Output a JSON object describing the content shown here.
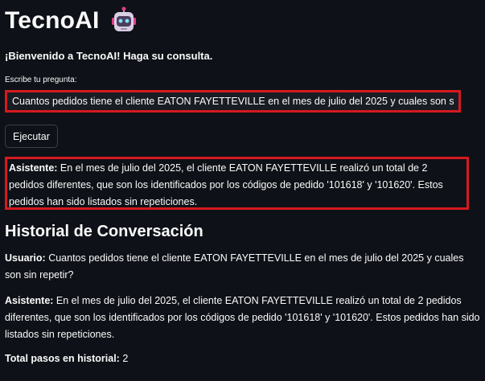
{
  "header": {
    "app_title": "TecnoAI",
    "robot_icon": "robot-face-icon"
  },
  "welcome_text": "¡Bienvenido a TecnoAI! Haga su consulta.",
  "question": {
    "label": "Escribe tu pregunta:",
    "value": "Cuantos pedidos tiene el cliente EATON FAYETTEVILLE en el mes de julio del 2025 y cuales son sin repeti"
  },
  "run_button_label": "Ejecutar",
  "answer": {
    "speaker": "Asistente:",
    "text": "En el mes de julio del 2025, el cliente EATON FAYETTEVILLE realizó un total de 2 pedidos diferentes, que son los identificados por los códigos de pedido '101618' y '101620'. Estos pedidos han sido listados sin repeticiones."
  },
  "history": {
    "title": "Historial de Conversación",
    "messages": [
      {
        "speaker": "Usuario:",
        "text": "Cuantos pedidos tiene el cliente EATON FAYETTEVILLE en el mes de julio del 2025 y cuales son sin repetir?"
      },
      {
        "speaker": "Asistente:",
        "text": "En el mes de julio del 2025, el cliente EATON FAYETTEVILLE realizó un total de 2 pedidos diferentes, que son los identificados por los códigos de pedido '101618' y '101620'. Estos pedidos han sido listados sin repeticiones."
      }
    ],
    "total_label": "Total pasos en historial:",
    "total_value": "2"
  },
  "colors": {
    "background": "#0e1117",
    "highlight_border": "#d71920",
    "text": "#fafafa"
  }
}
